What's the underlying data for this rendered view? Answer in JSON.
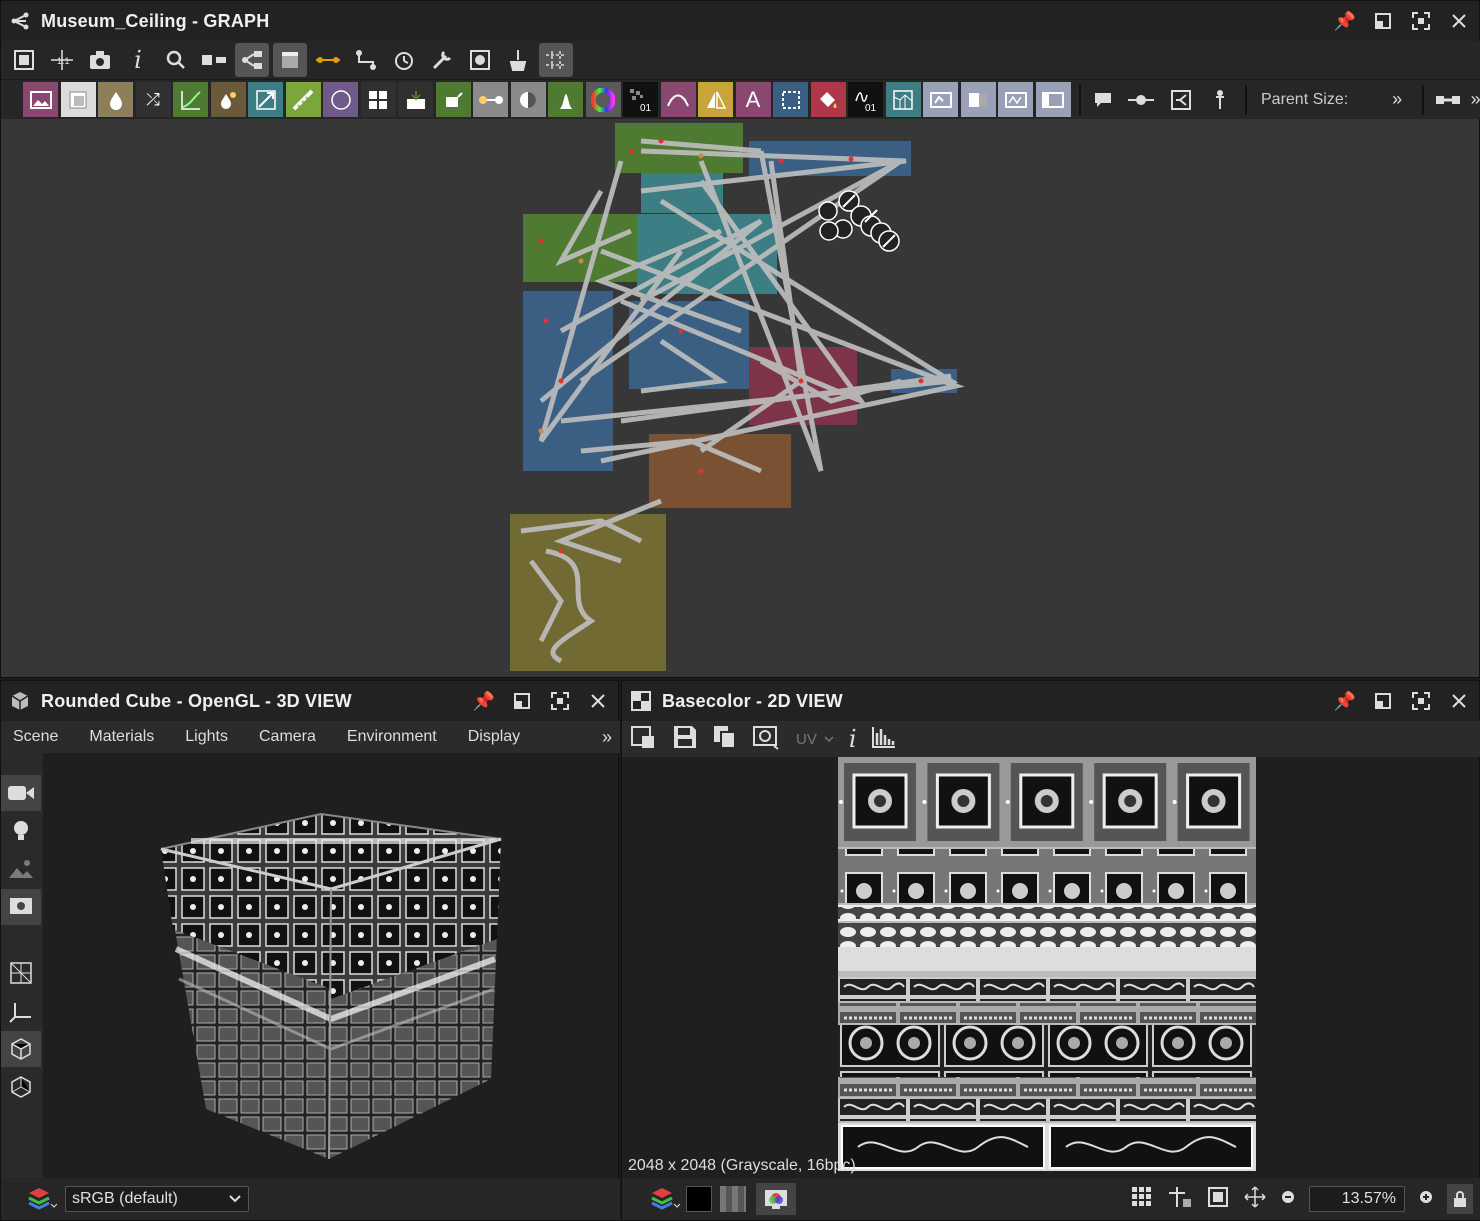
{
  "graph": {
    "title": "Museum_Ceiling - GRAPH",
    "parent_size_label": "Parent Size:",
    "colors": {
      "green": "#4e7a32",
      "blue": "#3a5f82",
      "teal": "#3d7d84",
      "red": "#7d3448",
      "orange": "#7a5233",
      "olive": "#726a33"
    }
  },
  "view3d": {
    "title": "Rounded Cube - OpenGL - 3D VIEW",
    "menu": [
      "Scene",
      "Materials",
      "Lights",
      "Camera",
      "Environment",
      "Display"
    ],
    "colorspace": "sRGB (default)"
  },
  "view2d": {
    "title": "Basecolor - 2D VIEW",
    "uv_label": "UV",
    "info": "2048 x 2048 (Grayscale, 16bpc)",
    "zoom": "13.57%"
  }
}
